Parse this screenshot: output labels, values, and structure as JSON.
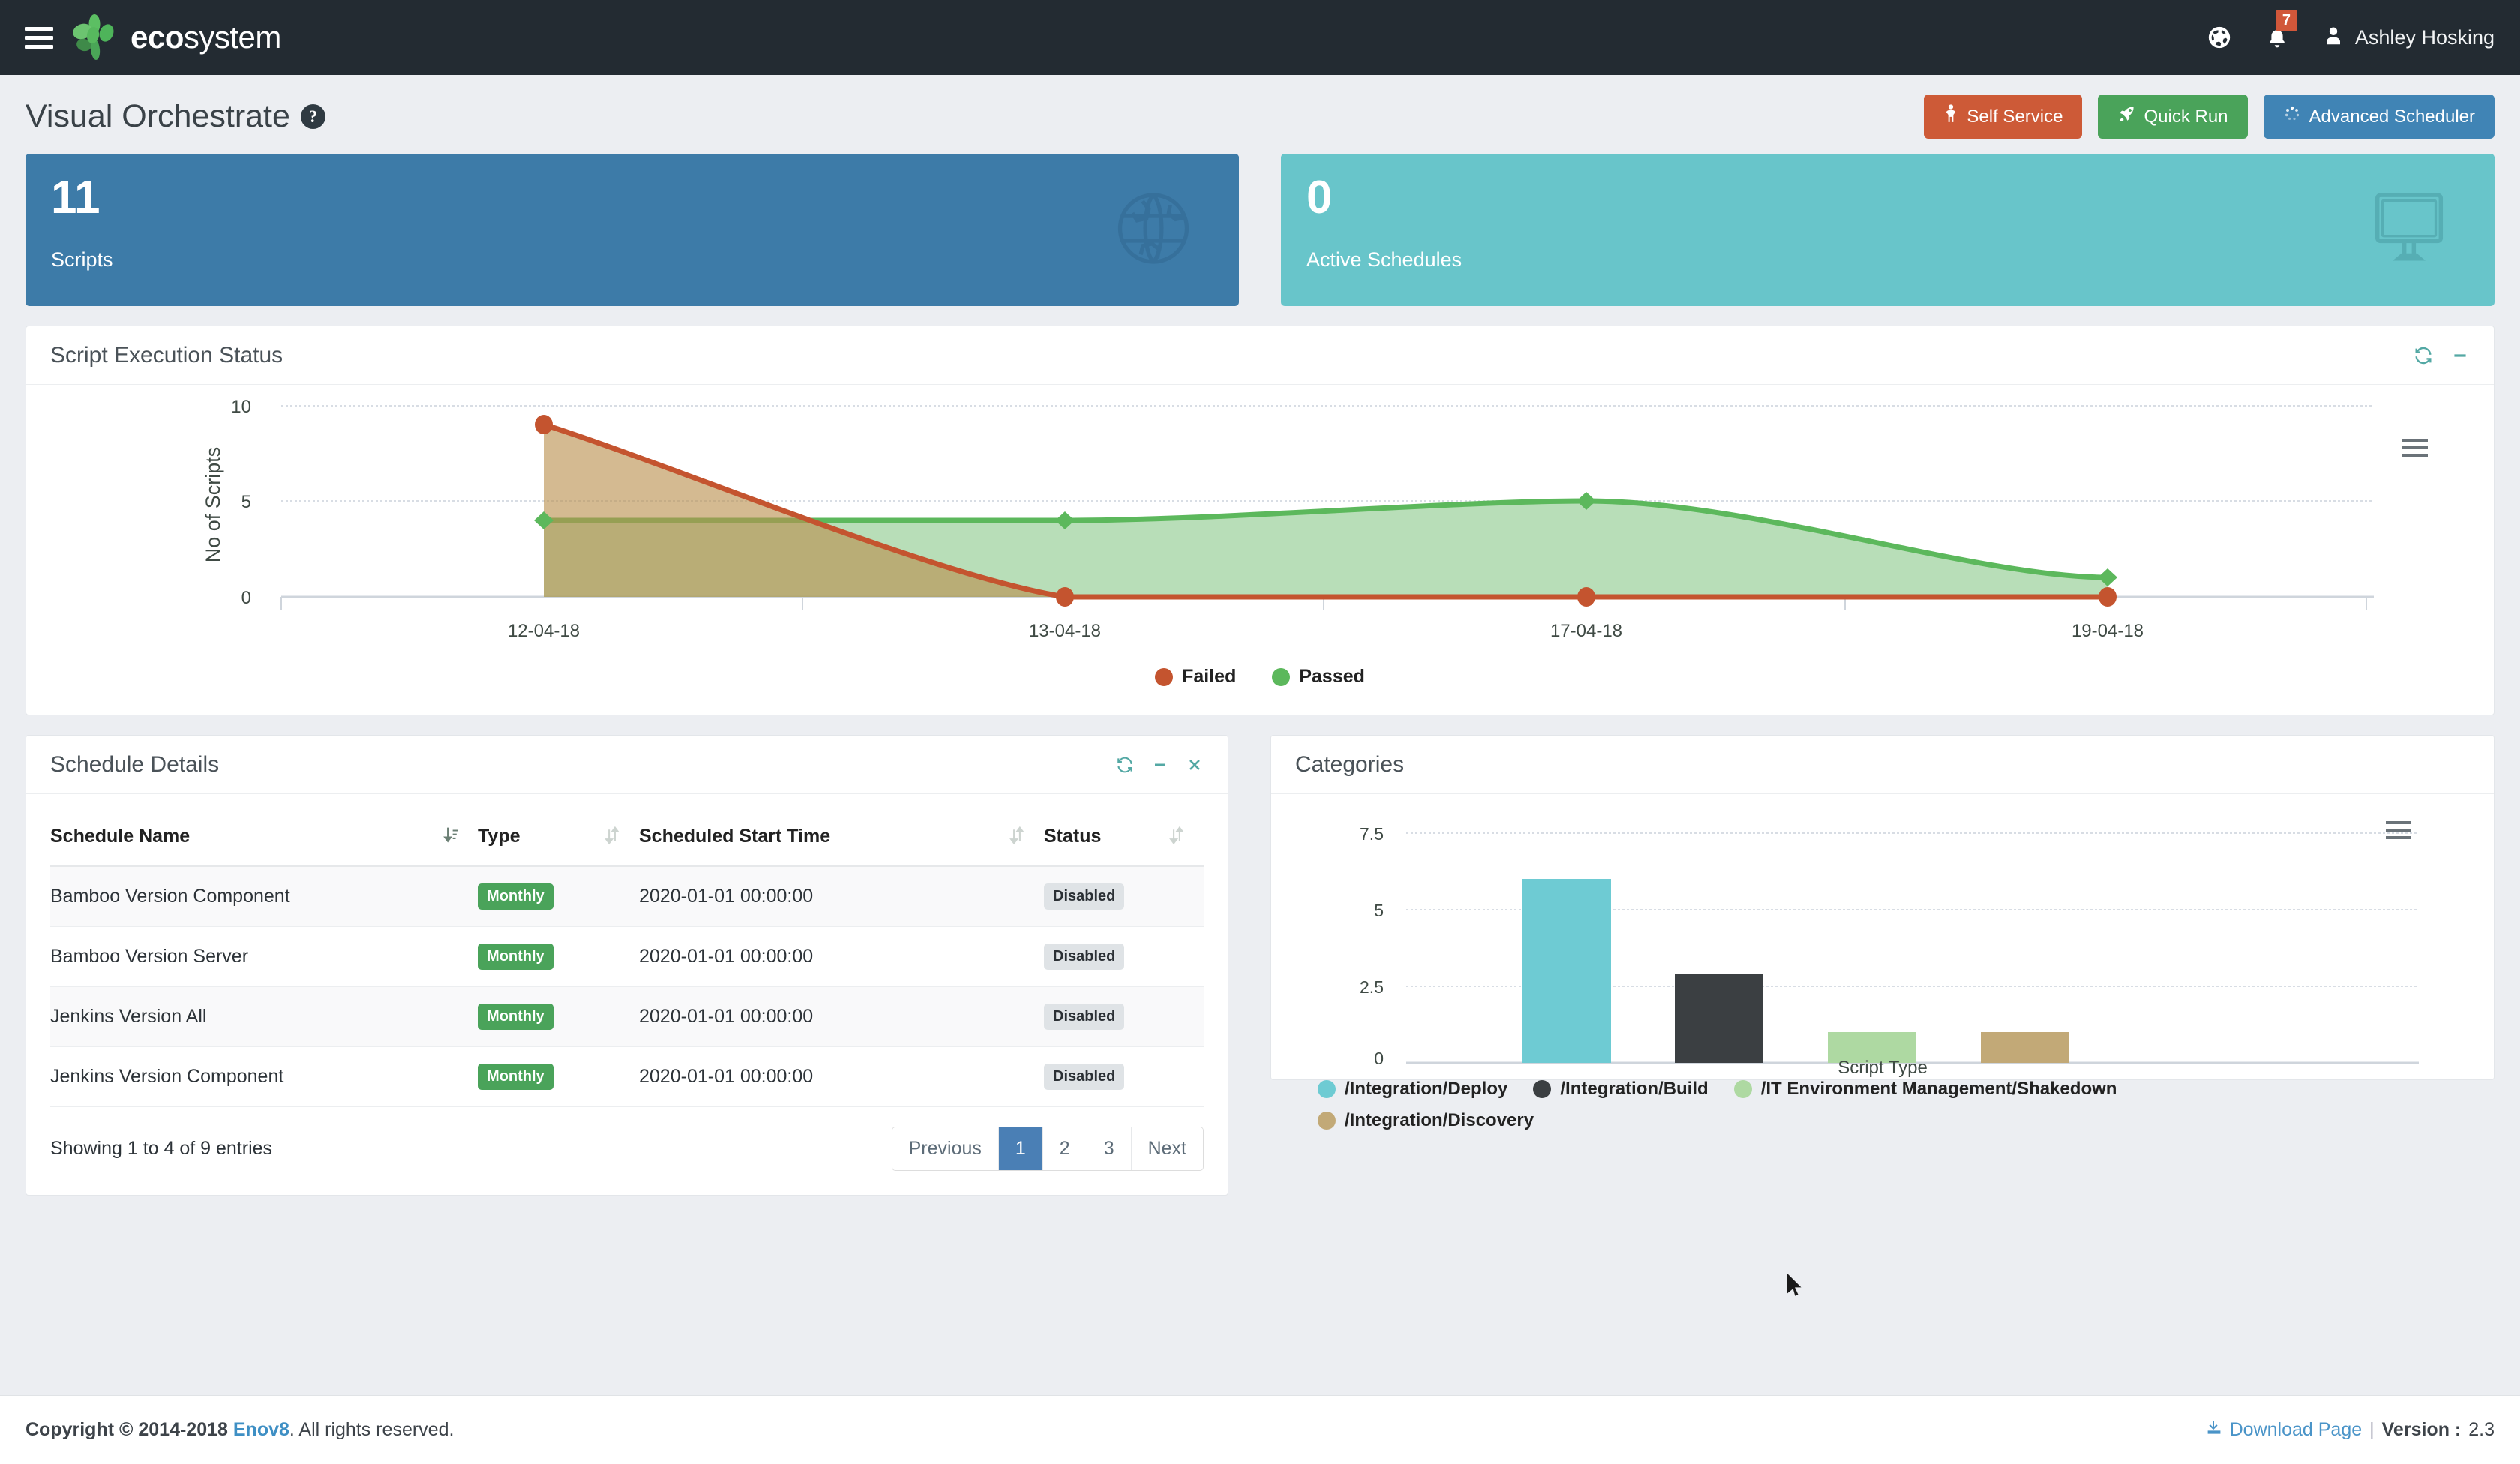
{
  "navbar": {
    "brand_bold": "eco",
    "brand_light": "system",
    "menu_icon": "hamburger-menu-icon",
    "globe_icon": "globe-icon",
    "bell_icon": "bell-icon",
    "notification_count": "7",
    "user_icon": "user-icon",
    "user_name": "Ashley Hosking"
  },
  "page": {
    "title": "Visual Orchestrate",
    "help_icon": "question-mark-icon",
    "buttons": [
      {
        "label": "Self Service",
        "icon": "person-icon",
        "color": "#cd5a37"
      },
      {
        "label": "Quick Run",
        "icon": "rocket-icon",
        "color": "#4aa35a"
      },
      {
        "label": "Advanced Scheduler",
        "icon": "spinner-icon",
        "color": "#4084b5"
      }
    ]
  },
  "stats": [
    {
      "value": "11",
      "label": "Scripts",
      "icon": "globe-icon",
      "color": "#3d7ba8"
    },
    {
      "value": "0",
      "label": "Active Schedules",
      "icon": "desktop-monitor-icon",
      "color": "#68c5ca"
    }
  ],
  "execution_panel": {
    "title": "Script Execution Status",
    "refresh_icon": "refresh-icon",
    "minimize_icon": "minimize-icon",
    "menu_icon": "context-menu-icon"
  },
  "schedule_panel": {
    "title": "Schedule Details",
    "refresh_icon": "refresh-icon",
    "minimize_icon": "minimize-icon",
    "close_icon": "close-icon",
    "columns": [
      "Schedule Name",
      "Type",
      "Scheduled Start Time",
      "Status"
    ],
    "rows": [
      {
        "name": "Bamboo Version Component",
        "type": "Monthly",
        "start": "2020-01-01 00:00:00",
        "status": "Disabled"
      },
      {
        "name": "Bamboo Version Server",
        "type": "Monthly",
        "start": "2020-01-01 00:00:00",
        "status": "Disabled"
      },
      {
        "name": "Jenkins Version All",
        "type": "Monthly",
        "start": "2020-01-01 00:00:00",
        "status": "Disabled"
      },
      {
        "name": "Jenkins Version Component",
        "type": "Monthly",
        "start": "2020-01-01 00:00:00",
        "status": "Disabled"
      }
    ],
    "entries_info": "Showing 1 to 4 of 9 entries",
    "pagination": {
      "previous": "Previous",
      "pages": [
        "1",
        "2",
        "3"
      ],
      "active": "1",
      "next": "Next"
    }
  },
  "categories_panel": {
    "title": "Categories",
    "menu_icon": "context-menu-icon"
  },
  "footer": {
    "copyright_prefix": "Copyright © 2014-2018",
    "company": "Enov8",
    "copyright_suffix": ". All rights reserved.",
    "download_icon": "download-icon",
    "download_label": "Download Page",
    "separator": "|",
    "version_label": "Version :",
    "version_value": "2.3"
  },
  "chart_data": [
    {
      "type": "area",
      "title": "Script Execution Status",
      "xlabel": "",
      "ylabel": "No of Scripts",
      "categories": [
        "12-04-18",
        "13-04-18",
        "17-04-18",
        "19-04-18"
      ],
      "ylim": [
        0,
        10
      ],
      "yticks": [
        "0",
        "5",
        "10"
      ],
      "grid": true,
      "legend_position": "bottom",
      "series": [
        {
          "name": "Failed",
          "color": "#c4542f",
          "values": [
            9,
            0,
            0,
            0
          ]
        },
        {
          "name": "Passed",
          "color": "#5cb85c",
          "values": [
            4,
            4,
            5,
            1
          ]
        }
      ]
    },
    {
      "type": "bar",
      "title": "Categories",
      "xlabel": "Script Type",
      "ylabel": "",
      "ylim": [
        0,
        7.5
      ],
      "yticks": [
        "0",
        "2.5",
        "5",
        "7.5"
      ],
      "grid": true,
      "legend_position": "bottom",
      "categories": [
        "/Integration/Deploy",
        "/Integration/Build",
        "/IT Environment Management/Shakedown",
        "/Integration/Discovery"
      ],
      "values": [
        6,
        2.9,
        1,
        1
      ],
      "colors": [
        "#6ecbd3",
        "#3b3f42",
        "#aed9a2",
        "#c2a977"
      ]
    }
  ]
}
